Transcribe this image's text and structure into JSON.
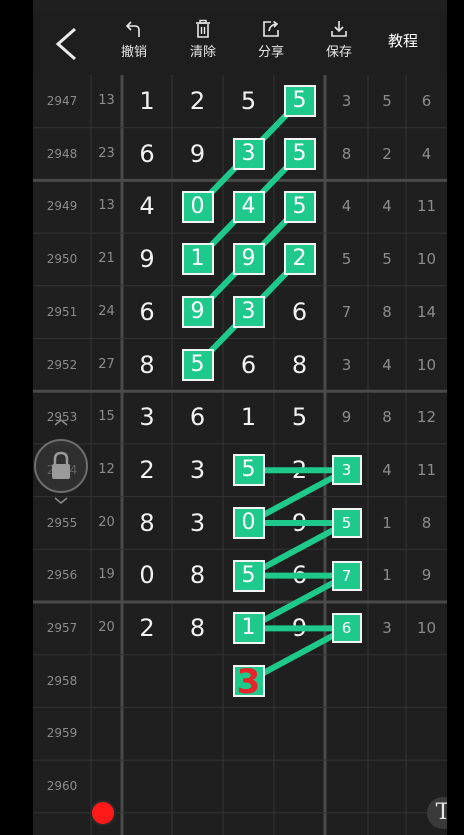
{
  "toolbar": {
    "undo_label": "撤销",
    "clear_label": "清除",
    "share_label": "分享",
    "save_label": "保存",
    "tutorial_label": "教程"
  },
  "rows": [
    {
      "period": "2947",
      "sum": "13",
      "digits": [
        "1",
        "2",
        "5",
        "5"
      ],
      "side": [
        "3",
        "5",
        "6"
      ]
    },
    {
      "period": "2948",
      "sum": "23",
      "digits": [
        "6",
        "9",
        "3",
        "5"
      ],
      "side": [
        "8",
        "2",
        "4"
      ]
    },
    {
      "period": "2949",
      "sum": "13",
      "digits": [
        "4",
        "0",
        "4",
        "5"
      ],
      "side": [
        "4",
        "4",
        "11"
      ]
    },
    {
      "period": "2950",
      "sum": "21",
      "digits": [
        "9",
        "1",
        "9",
        "2"
      ],
      "side": [
        "5",
        "5",
        "10"
      ]
    },
    {
      "period": "2951",
      "sum": "24",
      "digits": [
        "6",
        "9",
        "3",
        "6"
      ],
      "side": [
        "7",
        "8",
        "14"
      ]
    },
    {
      "period": "2952",
      "sum": "27",
      "digits": [
        "8",
        "5",
        "6",
        "8"
      ],
      "side": [
        "3",
        "4",
        "10"
      ]
    },
    {
      "period": "2953",
      "sum": "15",
      "digits": [
        "3",
        "6",
        "1",
        "5"
      ],
      "side": [
        "9",
        "8",
        "12"
      ]
    },
    {
      "period": "2954",
      "sum": "12",
      "digits": [
        "2",
        "3",
        "5",
        "2"
      ],
      "side": [
        "3",
        "4",
        "11"
      ]
    },
    {
      "period": "2955",
      "sum": "20",
      "digits": [
        "8",
        "3",
        "0",
        "9"
      ],
      "side": [
        "5",
        "1",
        "8"
      ]
    },
    {
      "period": "2956",
      "sum": "19",
      "digits": [
        "0",
        "8",
        "5",
        "6"
      ],
      "side": [
        "7",
        "1",
        "9"
      ]
    },
    {
      "period": "2957",
      "sum": "20",
      "digits": [
        "2",
        "8",
        "1",
        "9"
      ],
      "side": [
        "6",
        "3",
        "10"
      ]
    },
    {
      "period": "2958",
      "sum": "",
      "digits": [
        "",
        "",
        "",
        "",
        ""
      ],
      "side": [
        "",
        "",
        ""
      ]
    },
    {
      "period": "2959",
      "sum": "",
      "digits": [
        "",
        "",
        "",
        ""
      ],
      "side": [
        "",
        "",
        ""
      ]
    },
    {
      "period": "2960",
      "sum": "",
      "digits": [
        "",
        "",
        "",
        ""
      ],
      "side": [
        "",
        "",
        ""
      ]
    }
  ],
  "annotation": {
    "value": "3",
    "color": "#e8232a"
  },
  "text_tool_label": "T",
  "colors": {
    "highlight": "#1ec98b",
    "record": "#ff1a1a"
  }
}
